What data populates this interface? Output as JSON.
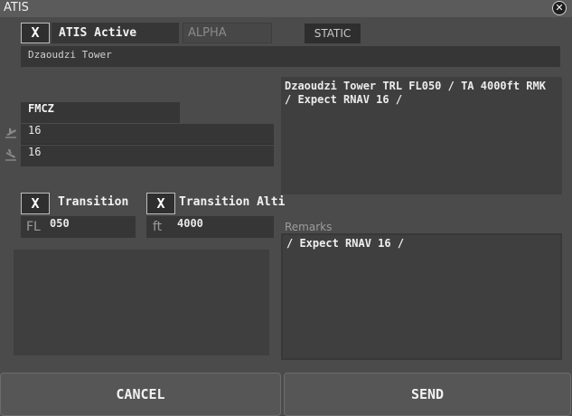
{
  "window": {
    "title": "ATIS"
  },
  "header": {
    "atis_active_check": "X",
    "atis_active_label": "ATIS Active",
    "letter": "ALPHA",
    "mode_button": "STATIC",
    "station_name": "Dzaoudzi Tower"
  },
  "airport": {
    "icao": "FMCZ",
    "departure_runway": "16",
    "arrival_runway": "16"
  },
  "preview": {
    "text": "Dzaoudzi Tower TRL FL050 / TA 4000ft RMK / Expect RNAV 16 /"
  },
  "transition": {
    "level_check": "X",
    "level_label": "Transition",
    "level_unit": "FL",
    "level_value": "050",
    "altitude_check": "X",
    "altitude_label": "Transition Alti",
    "altitude_unit": "ft",
    "altitude_value": "4000"
  },
  "remarks": {
    "label": "Remarks",
    "value": "/ Expect RNAV 16 /"
  },
  "footer": {
    "cancel_label": "CANCEL",
    "send_label": "SEND"
  },
  "icons": {
    "departure": "plane-departure-icon",
    "arrival": "plane-arrival-icon",
    "close": "close-icon"
  }
}
